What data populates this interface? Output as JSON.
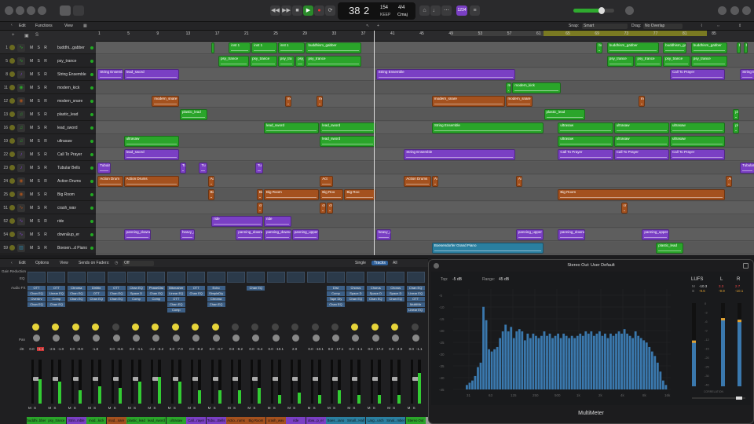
{
  "control_bar": {
    "position_bar": "38",
    "position_beat": "2",
    "tempo": "154",
    "tempo_label": "KEEP",
    "signature": "4/4",
    "key": "Cmaj",
    "count_badge": "1234"
  },
  "tracks_toolbar": {
    "edit": "Edit",
    "functions": "Functions",
    "view": "View",
    "snap_label": "Snap:",
    "snap_value": "Smart",
    "drag_label": "Drag:",
    "drag_value": "No Overlap"
  },
  "ruler": {
    "bars": [
      "1",
      "5",
      "9",
      "13",
      "17",
      "21",
      "25",
      "29",
      "33",
      "37",
      "41",
      "45",
      "49",
      "53",
      "57",
      "61",
      "65",
      "69",
      "73",
      "77",
      "81",
      "85"
    ]
  },
  "tracks": [
    {
      "num": "1",
      "name": "buddhi...gabber",
      "icon": "waveform-icon",
      "color": "#2aa52a"
    },
    {
      "num": "5",
      "name": "psy_trance",
      "icon": "waveform-icon",
      "color": "#2aa52a"
    },
    {
      "num": "8",
      "name": "String Ensemble",
      "icon": "strings-icon",
      "color": "#7a3fc4"
    },
    {
      "num": "11",
      "name": "modern_kick",
      "icon": "drum-icon",
      "color": "#2aa52a"
    },
    {
      "num": "12",
      "name": "modern_snare",
      "icon": "drum-icon",
      "color": "#a4511e"
    },
    {
      "num": "13",
      "name": "plastic_lead",
      "icon": "synth-icon",
      "color": "#2aa52a"
    },
    {
      "num": "16",
      "name": "lead_sword",
      "icon": "synth-icon",
      "color": "#2aa52a"
    },
    {
      "num": "19",
      "name": "ultrasaw",
      "icon": "synth-icon",
      "color": "#2aa52a"
    },
    {
      "num": "22",
      "name": "Call To Prayer",
      "icon": "voice-icon",
      "color": "#7a3fc4"
    },
    {
      "num": "23",
      "name": "Tubular Bells",
      "icon": "bells-icon",
      "color": "#7a3fc4"
    },
    {
      "num": "24",
      "name": "Action Drums",
      "icon": "drum-icon",
      "color": "#a4511e"
    },
    {
      "num": "25",
      "name": "Big Room",
      "icon": "drum-icon",
      "color": "#a4511e"
    },
    {
      "num": "51",
      "name": "crash_wav",
      "icon": "waveform-icon",
      "color": "#a4511e"
    },
    {
      "num": "52",
      "name": "ride",
      "icon": "waveform-icon",
      "color": "#7a3fc4"
    },
    {
      "num": "54",
      "name": "down&up_er",
      "icon": "waveform-icon",
      "color": "#7a3fc4"
    },
    {
      "num": "59",
      "name": "Boesen...d Piano",
      "icon": "piano-icon",
      "color": "#2a7fa0"
    }
  ],
  "regions": [
    {
      "row": 0,
      "label": "bu",
      "s": 33.0,
      "e": 34.0,
      "c": "#2aa52a"
    },
    {
      "row": 0,
      "label": "inst 1",
      "s": 38.0,
      "e": 44.5,
      "c": "#2aa52a"
    },
    {
      "row": 0,
      "label": "inst 1",
      "s": 44.5,
      "e": 52.0,
      "c": "#2aa52a"
    },
    {
      "row": 0,
      "label": "inst 1",
      "s": 52.0,
      "e": 60.0,
      "c": "#2aa52a"
    },
    {
      "row": 0,
      "label": "buddhism_gabber",
      "s": 60.0,
      "e": 76.0,
      "c": "#2aa52a"
    },
    {
      "row": 0,
      "label": "bu",
      "s": 143.0,
      "e": 145.0,
      "c": "#2aa52a"
    },
    {
      "row": 0,
      "label": "buddhism_gabber",
      "s": 146.0,
      "e": 161.0,
      "c": "#2aa52a"
    },
    {
      "row": 0,
      "label": "buddhism_gabber",
      "s": 162.0,
      "e": 169.0,
      "c": "#2aa52a"
    },
    {
      "row": 0,
      "label": "buddhism_gabber",
      "s": 170.0,
      "e": 180.5,
      "c": "#2aa52a"
    },
    {
      "row": 0,
      "label": "b",
      "s": 183.0,
      "e": 184.5,
      "c": "#2aa52a"
    },
    {
      "row": 0,
      "label": "b",
      "s": 185.0,
      "e": 186.5,
      "c": "#2aa52a"
    },
    {
      "row": 1,
      "label": "psy_trance",
      "s": 35.0,
      "e": 44.0,
      "c": "#2aa52a"
    },
    {
      "row": 1,
      "label": "psy_trance",
      "s": 44.0,
      "e": 52.0,
      "c": "#2aa52a"
    },
    {
      "row": 1,
      "label": "psy_tra",
      "s": 52.0,
      "e": 57.0,
      "c": "#2aa52a"
    },
    {
      "row": 1,
      "label": "psy_tra",
      "s": 57.0,
      "e": 60.0,
      "c": "#2aa52a"
    },
    {
      "row": 1,
      "label": "psy_trance",
      "s": 60.0,
      "e": 76.0,
      "c": "#2aa52a"
    },
    {
      "row": 1,
      "label": "psy_trance",
      "s": 146.0,
      "e": 154.0,
      "c": "#2aa52a"
    },
    {
      "row": 1,
      "label": "psy_trance",
      "s": 154.0,
      "e": 162.0,
      "c": "#2aa52a"
    },
    {
      "row": 1,
      "label": "psy_trance",
      "s": 162.0,
      "e": 170.0,
      "c": "#2aa52a"
    },
    {
      "row": 1,
      "label": "psy_trance",
      "s": 170.0,
      "e": 180.5,
      "c": "#2aa52a"
    },
    {
      "row": 2,
      "label": "String Ensemble",
      "s": 0.5,
      "e": 8.0,
      "c": "#7a3fc4"
    },
    {
      "row": 2,
      "label": "lead_sword",
      "s": 8.0,
      "e": 24.0,
      "c": "#7a3fc4"
    },
    {
      "row": 2,
      "label": "String Ensemble",
      "s": 80.0,
      "e": 120.0,
      "c": "#7a3fc4"
    },
    {
      "row": 2,
      "label": "Call To Prayer",
      "s": 164.0,
      "e": 180.0,
      "c": "#7a3fc4"
    },
    {
      "row": 2,
      "label": "String E",
      "s": 184.0,
      "e": 188.5,
      "c": "#7a3fc4"
    },
    {
      "row": 3,
      "label": "mo",
      "s": 117.0,
      "e": 119.0,
      "c": "#2aa52a"
    },
    {
      "row": 3,
      "label": "modern_kick",
      "s": 119.0,
      "e": 133.0,
      "c": "#2aa52a"
    },
    {
      "row": 4,
      "label": "modern_snare",
      "s": 16.0,
      "e": 24.0,
      "c": "#a4511e"
    },
    {
      "row": 4,
      "label": "mo",
      "s": 54.0,
      "e": 56.0,
      "c": "#a4511e"
    },
    {
      "row": 4,
      "label": "mo",
      "s": 63.0,
      "e": 65.0,
      "c": "#a4511e"
    },
    {
      "row": 4,
      "label": "modern_snare",
      "s": 96.0,
      "e": 117.0,
      "c": "#a4511e"
    },
    {
      "row": 4,
      "label": "modern_snare",
      "s": 117.0,
      "e": 125.0,
      "c": "#a4511e"
    },
    {
      "row": 4,
      "label": "mo",
      "s": 155.0,
      "e": 157.0,
      "c": "#a4511e"
    },
    {
      "row": 5,
      "label": "plastic_lead",
      "s": 24.0,
      "e": 32.0,
      "c": "#2aa52a"
    },
    {
      "row": 5,
      "label": "plastic_lead",
      "s": 128.0,
      "e": 140.0,
      "c": "#2aa52a"
    },
    {
      "row": 5,
      "label": "pl",
      "s": 182.0,
      "e": 184.0,
      "c": "#2aa52a"
    },
    {
      "row": 6,
      "label": "lead_sword",
      "s": 48.0,
      "e": 64.0,
      "c": "#2aa52a"
    },
    {
      "row": 6,
      "label": "lead_sword",
      "s": 64.0,
      "e": 80.0,
      "c": "#2aa52a"
    },
    {
      "row": 6,
      "label": "String Ensemble",
      "s": 96.0,
      "e": 128.0,
      "c": "#2aa52a"
    },
    {
      "row": 6,
      "label": "ultrasaw",
      "s": 132.0,
      "e": 148.0,
      "c": "#2aa52a"
    },
    {
      "row": 6,
      "label": "ultrasaw",
      "s": 148.0,
      "e": 164.0,
      "c": "#2aa52a"
    },
    {
      "row": 6,
      "label": "ultrasaw",
      "s": 164.0,
      "e": 180.0,
      "c": "#2aa52a"
    },
    {
      "row": 6,
      "label": "pla",
      "s": 182.0,
      "e": 184.0,
      "c": "#2aa52a"
    },
    {
      "row": 7,
      "label": "ultrasaw",
      "s": 8.0,
      "e": 24.0,
      "c": "#2aa52a"
    },
    {
      "row": 7,
      "label": "lead_sword",
      "s": 64.0,
      "e": 80.0,
      "c": "#2aa52a"
    },
    {
      "row": 7,
      "label": "ultrasaw",
      "s": 132.0,
      "e": 148.0,
      "c": "#2aa52a"
    },
    {
      "row": 7,
      "label": "ultrasaw",
      "s": 148.0,
      "e": 164.0,
      "c": "#2aa52a"
    },
    {
      "row": 7,
      "label": "ultrasaw",
      "s": 164.0,
      "e": 180.0,
      "c": "#2aa52a"
    },
    {
      "row": 8,
      "label": "lead_sword",
      "s": 8.0,
      "e": 24.0,
      "c": "#7a3fc4"
    },
    {
      "row": 8,
      "label": "String Ensemble",
      "s": 88.0,
      "e": 120.0,
      "c": "#7a3fc4"
    },
    {
      "row": 8,
      "label": "Call To Prayer",
      "s": 132.0,
      "e": 148.0,
      "c": "#7a3fc4"
    },
    {
      "row": 8,
      "label": "Call To Prayer",
      "s": 148.0,
      "e": 164.0,
      "c": "#7a3fc4"
    },
    {
      "row": 8,
      "label": "Call To Prayer",
      "s": 164.0,
      "e": 180.0,
      "c": "#7a3fc4"
    },
    {
      "row": 9,
      "label": "Tubular",
      "s": 0.5,
      "e": 4.5,
      "c": "#7a3fc4"
    },
    {
      "row": 9,
      "label": "Tu",
      "s": 24.0,
      "e": 26.0,
      "c": "#7a3fc4"
    },
    {
      "row": 9,
      "label": "Tu",
      "s": 29.5,
      "e": 32.0,
      "c": "#7a3fc4"
    },
    {
      "row": 9,
      "label": "Tu",
      "s": 45.5,
      "e": 48.0,
      "c": "#7a3fc4"
    },
    {
      "row": 9,
      "label": "Tubular",
      "s": 184.0,
      "e": 188.5,
      "c": "#7a3fc4"
    },
    {
      "row": 10,
      "label": "Action Drum",
      "s": 0.5,
      "e": 8.0,
      "c": "#a4511e"
    },
    {
      "row": 10,
      "label": "Action Drums",
      "s": 8.0,
      "e": 24.0,
      "c": "#a4511e"
    },
    {
      "row": 10,
      "label": "Ac",
      "s": 32.0,
      "e": 34.0,
      "c": "#a4511e"
    },
    {
      "row": 10,
      "label": "Act",
      "s": 64.0,
      "e": 68.0,
      "c": "#a4511e"
    },
    {
      "row": 10,
      "label": "Action Drums",
      "s": 88.0,
      "e": 96.0,
      "c": "#a4511e"
    },
    {
      "row": 10,
      "label": "Act",
      "s": 96.0,
      "e": 98.0,
      "c": "#a4511e"
    },
    {
      "row": 10,
      "label": "Act",
      "s": 120.0,
      "e": 122.0,
      "c": "#a4511e"
    },
    {
      "row": 10,
      "label": "Act",
      "s": 180.0,
      "e": 182.0,
      "c": "#a4511e"
    },
    {
      "row": 11,
      "label": "Big",
      "s": 32.0,
      "e": 34.0,
      "c": "#a4511e"
    },
    {
      "row": 11,
      "label": "Big",
      "s": 46.0,
      "e": 48.0,
      "c": "#a4511e"
    },
    {
      "row": 11,
      "label": "Big Room",
      "s": 48.0,
      "e": 64.0,
      "c": "#a4511e"
    },
    {
      "row": 11,
      "label": "Big Roo",
      "s": 64.0,
      "e": 71.0,
      "c": "#a4511e"
    },
    {
      "row": 11,
      "label": "Big Roo",
      "s": 71.0,
      "e": 80.0,
      "c": "#a4511e"
    },
    {
      "row": 11,
      "label": "Big Room",
      "s": 132.0,
      "e": 180.0,
      "c": "#a4511e"
    },
    {
      "row": 12,
      "label": "cr",
      "s": 46.0,
      "e": 48.0,
      "c": "#a4511e"
    },
    {
      "row": 12,
      "label": "cra",
      "s": 64.0,
      "e": 66.0,
      "c": "#a4511e"
    },
    {
      "row": 12,
      "label": "cr",
      "s": 66.0,
      "e": 68.0,
      "c": "#a4511e"
    },
    {
      "row": 12,
      "label": "cr",
      "s": 150.0,
      "e": 152.0,
      "c": "#a4511e"
    },
    {
      "row": 13,
      "label": "ride",
      "s": 33.0,
      "e": 48.0,
      "c": "#7a3fc4"
    },
    {
      "row": 13,
      "label": "ride",
      "s": 48.0,
      "e": 56.0,
      "c": "#7a3fc4"
    },
    {
      "row": 14,
      "label": "panning_downer",
      "s": 8.0,
      "e": 16.0,
      "c": "#7a3fc4"
    },
    {
      "row": 14,
      "label": "heavy_d",
      "s": 24.0,
      "e": 28.5,
      "c": "#7a3fc4"
    },
    {
      "row": 14,
      "label": "panning_downer",
      "s": 40.0,
      "e": 48.0,
      "c": "#7a3fc4"
    },
    {
      "row": 14,
      "label": "panning_downer",
      "s": 48.0,
      "e": 56.0,
      "c": "#7a3fc4"
    },
    {
      "row": 14,
      "label": "panning_upper",
      "s": 56.0,
      "e": 64.0,
      "c": "#7a3fc4"
    },
    {
      "row": 14,
      "label": "heavy_d",
      "s": 80.0,
      "e": 84.5,
      "c": "#7a3fc4"
    },
    {
      "row": 14,
      "label": "panning_upper",
      "s": 120.0,
      "e": 128.0,
      "c": "#7a3fc4"
    },
    {
      "row": 14,
      "label": "panning_downer",
      "s": 132.0,
      "e": 140.0,
      "c": "#7a3fc4"
    },
    {
      "row": 14,
      "label": "panning_upper",
      "s": 156.0,
      "e": 164.0,
      "c": "#7a3fc4"
    },
    {
      "row": 15,
      "label": "Boesendorfer Grand Piano",
      "s": 96.0,
      "e": 128.0,
      "c": "#2a7fa0"
    },
    {
      "row": 15,
      "label": "plastic_lead",
      "s": 160.0,
      "e": 168.0,
      "c": "#2aa52a"
    }
  ],
  "mixer_toolbar": {
    "edit": "Edit",
    "options": "Options",
    "view": "View",
    "sends_on_faders": "Sends on Faders:",
    "sends_value": "Off",
    "single": "Single",
    "tracks": "Tracks",
    "all": "All"
  },
  "mixer_side_labels": {
    "gain_reduction": "Gain Reduction",
    "eq": "EQ",
    "audio_fx": "Audio FX",
    "pan": "Pan",
    "db": "dB"
  },
  "channels": [
    {
      "name": "buddhi..bber",
      "color": "#2aa52a",
      "plugins": [
        "OTT",
        "Chan EQ",
        "Overdrv",
        "Chan EQ"
      ],
      "vol": "0.0",
      "vol2": "+1.1",
      "meter": 0.55,
      "icon": "knob"
    },
    {
      "name": "psy_trance",
      "color": "#2aa52a",
      "plugins": [
        "OTT",
        "Linear EQ",
        "Comp",
        "Chan EQ"
      ],
      "vol": "-2.5",
      "vol2": "-1.0",
      "meter": 0.5,
      "icon": "knob"
    },
    {
      "name": "Strin..mble",
      "color": "#7a3fc4",
      "plugins": [
        "Chroma",
        "Chan EQ",
        "Chan EQ"
      ],
      "vol": "0.0",
      "vol2": "-0.8",
      "meter": 0.3,
      "icon": "knob"
    },
    {
      "name": "mod...kick",
      "color": "#2aa52a",
      "plugins": [
        "DirMix",
        "OTT",
        "Chan EQ"
      ],
      "vol": "-1.8",
      "vol2": "",
      "meter": 0.4,
      "icon": "knob"
    },
    {
      "name": "mod...nare",
      "color": "#a4511e",
      "plugins": [
        "OTT",
        "Chan EQ",
        "Chan EQ"
      ],
      "vol": "0.0",
      "vol2": "-6.6",
      "meter": 0.35,
      "icon": "drum"
    },
    {
      "name": "plastic_lead",
      "color": "#2aa52a",
      "plugins": [
        "Chan EQ",
        "Space D",
        "Comp"
      ],
      "vol": "0.0",
      "vol2": "-1.1",
      "meter": 0.5,
      "icon": "knob"
    },
    {
      "name": "lead_sword",
      "color": "#2aa52a",
      "plugins": [
        "PhaseDist",
        "Chan EQ",
        "Comp"
      ],
      "vol": "-3.2",
      "vol2": "-3.2",
      "meter": 0.6,
      "icon": "knob"
    },
    {
      "name": "ultrasaw",
      "color": "#2aa52a",
      "plugins": [
        "Bitcrusher",
        "Linear EQ",
        "OTT",
        "Chan EQ",
        "Comp"
      ],
      "vol": "0.0",
      "vol2": "-7.0",
      "meter": 0.5,
      "icon": "knob"
    },
    {
      "name": "Call...rayer",
      "color": "#7a3fc4",
      "plugins": [
        "OTT",
        "Chan EQ"
      ],
      "vol": "0.0",
      "vol2": "-8.2",
      "meter": 0.3,
      "icon": "knob"
    },
    {
      "name": "Tubu...Bells",
      "color": "#7a3fc4",
      "plugins": [
        "Echo",
        "SimpleDly",
        "Chroma",
        "Chan EQ"
      ],
      "vol": "0.0",
      "vol2": "-4.7",
      "meter": 0.3,
      "icon": "knob"
    },
    {
      "name": "Actio...rums",
      "color": "#a4511e",
      "plugins": [],
      "vol": "0.0",
      "vol2": "-9.2",
      "meter": 0.3,
      "icon": "drum"
    },
    {
      "name": "Big Room",
      "color": "#a4511e",
      "plugins": [
        "Chan EQ"
      ],
      "vol": "0.0",
      "vol2": "-5.4",
      "meter": 0.35,
      "icon": "drum"
    },
    {
      "name": "crash_wav",
      "color": "#a4511e",
      "plugins": [],
      "vol": "0.0",
      "vol2": "-10.1",
      "meter": 0.2,
      "icon": "wave"
    },
    {
      "name": "ride",
      "color": "#7a3fc4",
      "plugins": [],
      "vol": "2.0",
      "vol2": "",
      "meter": 0.25,
      "icon": "wave"
    },
    {
      "name": "dow...p_er",
      "color": "#7a3fc4",
      "plugins": [],
      "vol": "0.0",
      "vol2": "-10.1",
      "meter": 0.2,
      "icon": "wave"
    },
    {
      "name": "Boes...iano",
      "color": "#2a7fa0",
      "plugins": [
        "Dist",
        "Comp",
        "Tape Dly",
        "Chan EQ"
      ],
      "vol": "0.0",
      "vol2": "-17.1",
      "meter": 0.3,
      "icon": "piano"
    },
    {
      "name": "Small...Hall",
      "color": "#2a7fa0",
      "plugins": [
        "Chorus",
        "Space D",
        "Chan EQ"
      ],
      "vol": "0.0",
      "vol2": "-1.1",
      "meter": 0.2,
      "icon": "knob"
    },
    {
      "name": "Larg...urch",
      "color": "#2a7fa0",
      "plugins": [
        "Chorus",
        "Space D",
        "Chan EQ"
      ],
      "vol": "0.0",
      "vol2": "-17.2",
      "meter": 0.2,
      "icon": "knob"
    },
    {
      "name": "Smal...mber",
      "color": "#2a7fa0",
      "plugins": [
        "Chorus",
        "Space D",
        "Chan EQ"
      ],
      "vol": "0.0",
      "vol2": "-4.0",
      "meter": 0.2,
      "icon": "knob"
    },
    {
      "name": "Stereo Out",
      "color": "#2aa52a",
      "plugins": [
        "Chan EQ",
        "Linear EQ",
        "OTT",
        "MultiMtr",
        "Linear EQ"
      ],
      "vol": "0.0",
      "vol2": "-1.1",
      "meter": 0.7,
      "icon": "output"
    },
    {
      "name": "Master",
      "color": "#9a9a9a",
      "plugins": [],
      "vol": "",
      "vol2": "",
      "meter": 0.0,
      "icon": "none"
    }
  ],
  "multimeter": {
    "title": "Stereo Out: User Default",
    "footer": "MultiMeter",
    "top_label": "Top:",
    "top_value": "-5 dB",
    "range_label": "Range:",
    "range_value": "45 dB",
    "lufs_label": "LUFS",
    "l_label": "L",
    "r_label": "R",
    "lufs_rows": [
      [
        "M",
        "-10.3"
      ],
      [
        "S",
        "-9.6"
      ]
    ],
    "l_values": [
      "3.3",
      "-9.9"
    ],
    "r_values": [
      "2.7",
      "-10.1"
    ],
    "correlation": "CORRELATION",
    "freq_labels": [
      "31",
      "63",
      "125",
      "250",
      "500",
      "1k",
      "2k",
      "4k",
      "8k",
      "16k"
    ],
    "db_labels": [
      "-5",
      "-10",
      "-15",
      "-20",
      "-25",
      "-30",
      "-35",
      "-40",
      "-45"
    ],
    "level_labels": [
      "0",
      "-3",
      "-6",
      "-9",
      "-12",
      "-15",
      "-20",
      "-25",
      "-30",
      "-40"
    ],
    "accent_color": "#3a78ad",
    "chart_data": {
      "type": "bar",
      "title": "",
      "xlabel": "",
      "ylabel": "",
      "ylim": [
        -50,
        -5
      ],
      "values": [
        -48,
        -47,
        -46,
        -44,
        -40,
        -38,
        -13,
        -19,
        -32,
        -33,
        -32,
        -31,
        -27,
        -24,
        -21,
        -24,
        -22,
        -27,
        -24,
        -23,
        -24,
        -28,
        -25,
        -27,
        -25,
        -26,
        -27,
        -26,
        -24,
        -26,
        -25,
        -27,
        -26,
        -25,
        -27,
        -25,
        -26,
        -27,
        -26,
        -27,
        -26,
        -25,
        -26,
        -24,
        -25,
        -24,
        -26,
        -25,
        -24,
        -26,
        -25,
        -27,
        -25,
        -26,
        -25,
        -24,
        -25,
        -23,
        -25,
        -26,
        -27,
        -24,
        -26,
        -27,
        -28,
        -29,
        -31,
        -33,
        -35,
        -38,
        -42,
        -46,
        -48
      ],
      "levels": {
        "L": 0.82,
        "R": 0.8,
        "LUFS_M": 0.55,
        "LUFS_S": 0.5
      }
    }
  }
}
